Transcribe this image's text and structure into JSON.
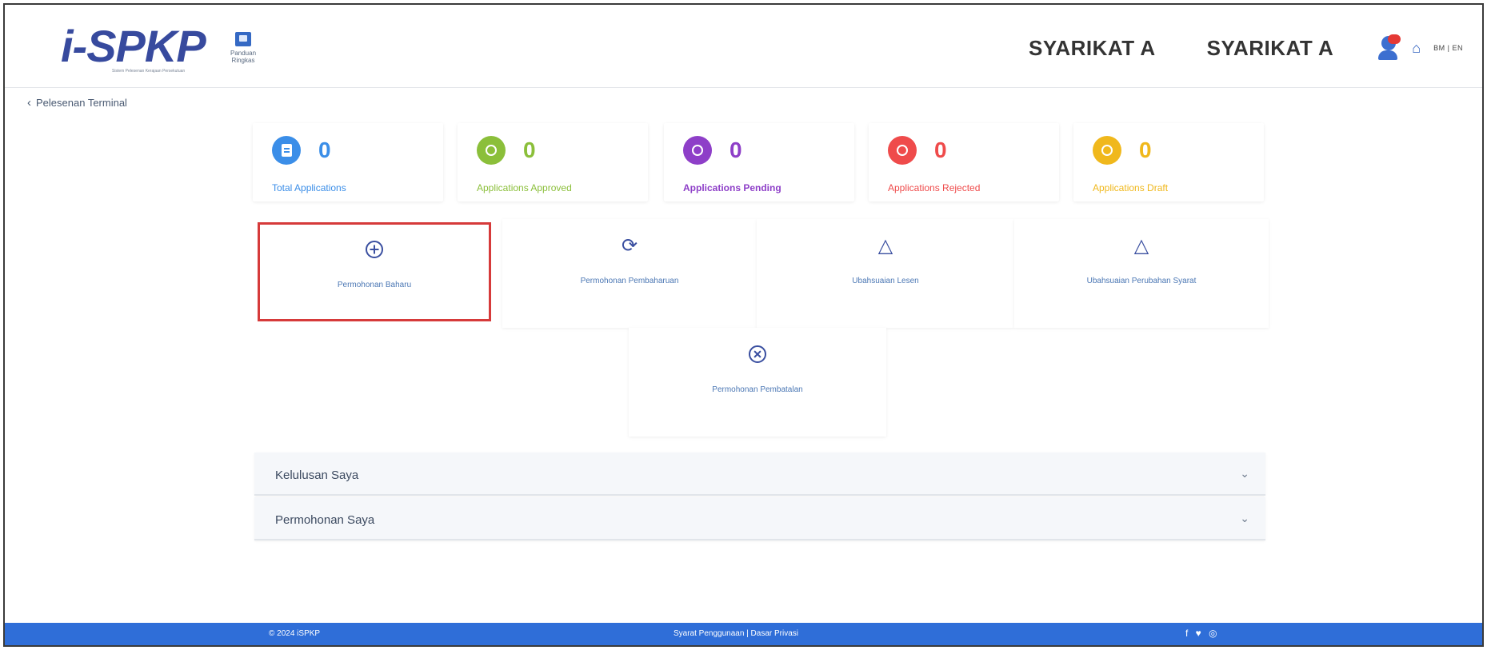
{
  "header": {
    "logo_text": "i-SPKP",
    "logo_tagline": "Sistem Pelesenan Kerajaan Persekutuan",
    "guide_label": "Panduan Ringkas",
    "company_1": "SYARIKAT A",
    "company_2": "SYARIKAT A",
    "language_toggle": "BM | EN"
  },
  "breadcrumb": {
    "back_label": "Pelesenan Terminal"
  },
  "stats": [
    {
      "count": "0",
      "label": "Total Applications",
      "color": "#3b8ee8",
      "icon": "document-icon"
    },
    {
      "count": "0",
      "label": "Applications Approved",
      "color": "#8bbf3a",
      "icon": "check-circle-icon"
    },
    {
      "count": "0",
      "label": "Applications Pending",
      "color": "#8e3fc8",
      "icon": "clock-icon"
    },
    {
      "count": "0",
      "label": "Applications Rejected",
      "color": "#ef4b4b",
      "icon": "x-circle-icon"
    },
    {
      "count": "0",
      "label": "Applications Draft",
      "color": "#f0b81c",
      "icon": "draft-icon"
    }
  ],
  "actions": [
    {
      "label": "Permohonan Baharu",
      "icon": "plus-circle-icon"
    },
    {
      "label": "Permohonan Pembaharuan",
      "icon": "refresh-icon"
    },
    {
      "label": "Ubahsuaian Lesen",
      "icon": "triangle-icon"
    },
    {
      "label": "Ubahsuaian Perubahan Syarat",
      "icon": "triangle-icon"
    },
    {
      "label": "Permohonan Pembatalan",
      "icon": "x-circle-icon"
    }
  ],
  "accordions": [
    {
      "title": "Kelulusan Saya"
    },
    {
      "title": "Permohonan Saya"
    }
  ],
  "footer": {
    "copyright": "© 2024 iSPKP",
    "links": "Syarat Penggunaan | Dasar Privasi",
    "social": "f ♥ ◎"
  }
}
